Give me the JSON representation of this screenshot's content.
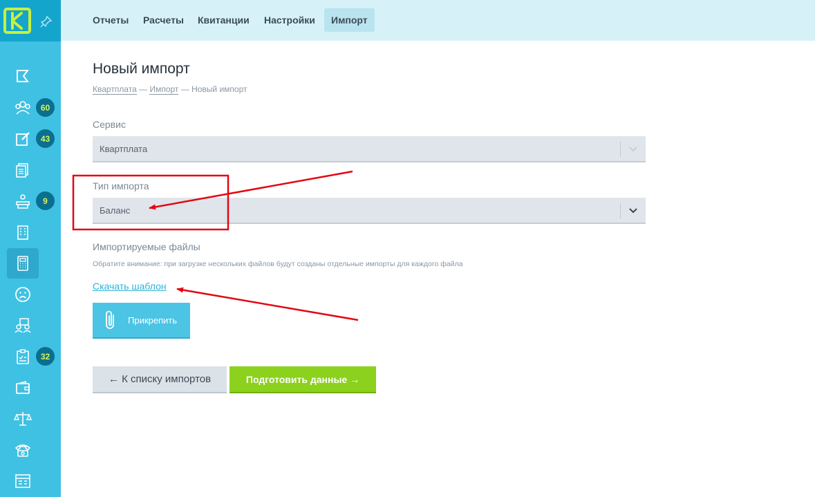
{
  "colors": {
    "sidebar": "#3fc1e3",
    "sidebar_top": "#14a5cc",
    "topbar": "#d6f2f8",
    "accent_link": "#2bb3d9",
    "primary_button": "#8cd11d",
    "badge_text": "#d6f55a",
    "annotation_red": "#e30613"
  },
  "sidebar": {
    "logo_letter": "K",
    "items": [
      {
        "icon": "flag-icon",
        "badge": ""
      },
      {
        "icon": "users-group-icon",
        "badge": "60"
      },
      {
        "icon": "edit-note-icon",
        "badge": "43"
      },
      {
        "icon": "documents-icon",
        "badge": ""
      },
      {
        "icon": "reception-desk-icon",
        "badge": "9"
      },
      {
        "icon": "building-icon",
        "badge": ""
      },
      {
        "icon": "calculator-icon",
        "badge": "",
        "active": true
      },
      {
        "icon": "sad-face-icon",
        "badge": ""
      },
      {
        "icon": "staff-list-icon",
        "badge": ""
      },
      {
        "icon": "clipboard-check-icon",
        "badge": "32"
      },
      {
        "icon": "wallet-icon",
        "badge": ""
      },
      {
        "icon": "scales-icon",
        "badge": ""
      },
      {
        "icon": "phone-icon",
        "badge": ""
      },
      {
        "icon": "browser-window-icon",
        "badge": ""
      }
    ]
  },
  "topbar": {
    "tabs": [
      {
        "label": "Отчеты"
      },
      {
        "label": "Расчеты"
      },
      {
        "label": "Квитанции"
      },
      {
        "label": "Настройки"
      },
      {
        "label": "Импорт",
        "active": true
      }
    ]
  },
  "main": {
    "title": "Новый импорт",
    "breadcrumb": {
      "item1": "Квартплата",
      "sep": "—",
      "item2": "Импорт",
      "current": "Новый импорт"
    },
    "service": {
      "label": "Сервис",
      "value": "Квартплата"
    },
    "import_type": {
      "label": "Тип импорта",
      "value": "Баланс"
    },
    "files": {
      "label": "Импортируемые файлы",
      "note": "Обратите внимание: при загрузке нескольких файлов будут созданы отдельные импорты для каждого файла",
      "template_link": "Скачать шаблон",
      "attach_button": "Прикрепить"
    },
    "buttons": {
      "back": "← К списку импортов",
      "next": "Подготовить данные →"
    }
  }
}
